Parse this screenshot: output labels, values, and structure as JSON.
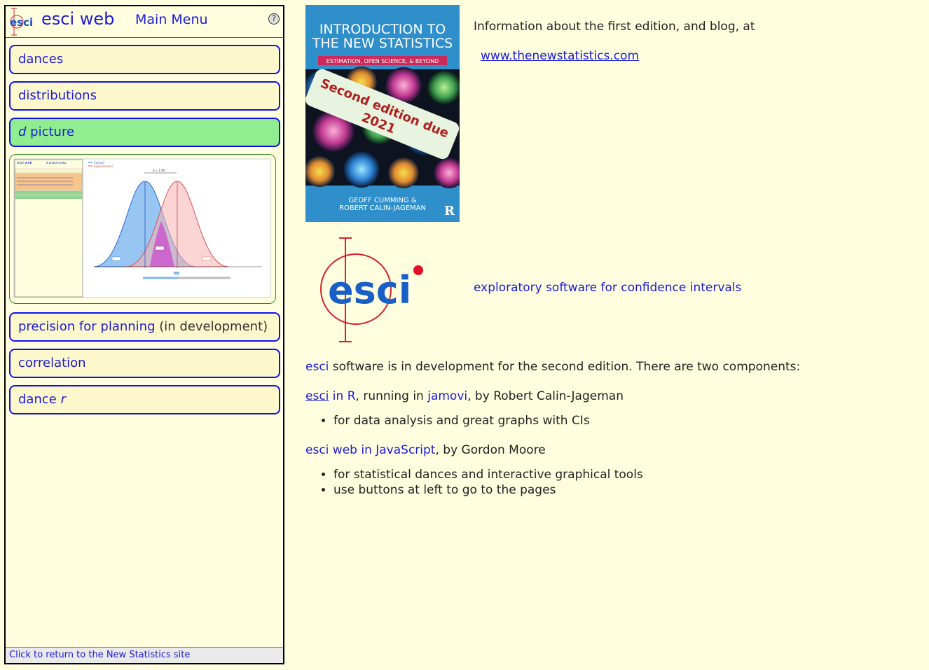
{
  "colors": {
    "background": "#ffffe0",
    "link": "#1a1add",
    "button_border": "#1010ee",
    "active_button": "#90ee90"
  },
  "header": {
    "logo_text": "esci",
    "app_title": "esci web",
    "menu_title": "Main Menu",
    "help_icon": "question-circle-icon",
    "help_glyph": "?"
  },
  "menu": {
    "dances": "dances",
    "distributions": "distributions",
    "dpicture_italic": "d",
    "dpicture_rest": " picture",
    "precision_link": "precision for planning",
    "precision_note": " (in development)",
    "correlation": "correlation",
    "dance_r_main": "dance ",
    "dance_r_italic": "r"
  },
  "preview": {
    "app_title": "esci web",
    "page_title": "d picture beta",
    "legend_control": "Control",
    "legend_experimental": "Experimental",
    "d_label": "d = 1.00"
  },
  "footer": {
    "text": "Click to return to the New Statistics site"
  },
  "book": {
    "title_line1": "INTRODUCTION TO",
    "title_line2": "THE NEW STATISTICS",
    "subtitle": "ESTIMATION, OPEN SCIENCE, & BEYOND",
    "badge_line1": "Second edition due",
    "badge_line2": "2021",
    "authors_line1": "GEOFF CUMMING &",
    "authors_line2": "ROBERT CALIN-JAGEMAN",
    "publisher_mark": "R"
  },
  "intro": {
    "info": "Information about the first edition, and blog, at",
    "site_link": "www.thenewstatistics.com"
  },
  "logo_big": {
    "text": "esci"
  },
  "tagline": "exploratory software for confidence intervals",
  "body": {
    "esci_word": "esci",
    "dev_text": " software is in development for the second edition. There are two components:",
    "r_esci": "esci",
    "r_inr": " in R",
    "r_running": ", running in ",
    "r_jamovi": "jamovi",
    "r_by": ", by Robert Calin-Jageman",
    "r_bullet": "for data analysis and great graphs with CIs",
    "web_link": "esci web in JavaScript",
    "web_by": ", by Gordon Moore",
    "web_bullet1": "for statistical dances and interactive graphical tools",
    "web_bullet2": "use buttons at left to go to the pages"
  }
}
